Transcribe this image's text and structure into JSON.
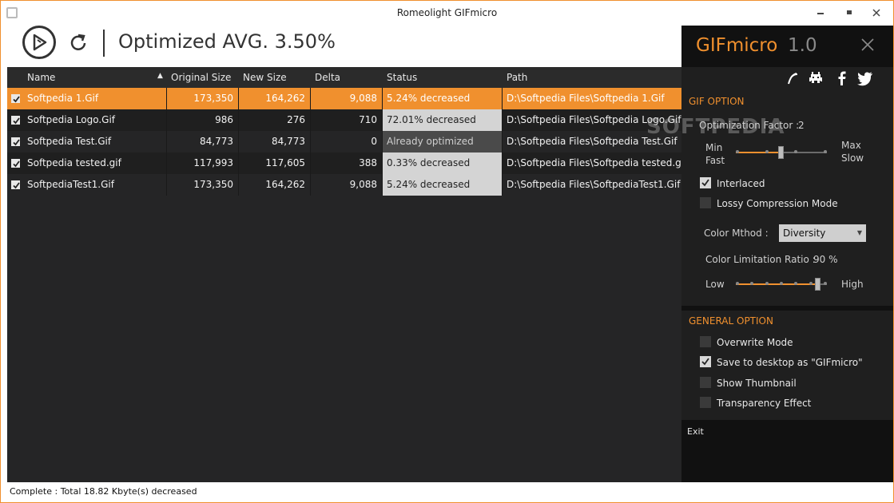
{
  "window": {
    "title": "Romeolight GIFmicro",
    "minimize_glyph": "▬",
    "maximize_glyph": "▪",
    "close_glyph": "✕"
  },
  "toolbar": {
    "optimized_text": "Optimized AVG. 3.50%"
  },
  "table": {
    "headers": {
      "name": "Name",
      "original_size": "Original Size",
      "new_size": "New Size",
      "delta": "Delta",
      "status": "Status",
      "path": "Path"
    },
    "sort_indicator": "▲",
    "rows": [
      {
        "checked": true,
        "name": "Softpedia 1.Gif",
        "original_size": "173,350",
        "new_size": "164,262",
        "delta": "9,088",
        "status": "5.24% decreased",
        "path": "D:\\Softpedia Files\\Softpedia 1.Gif",
        "selected": true
      },
      {
        "checked": true,
        "name": "Softpedia Logo.Gif",
        "original_size": "986",
        "new_size": "276",
        "delta": "710",
        "status": "72.01% decreased",
        "path": "D:\\Softpedia Files\\Softpedia Logo.Gif",
        "selected": false
      },
      {
        "checked": true,
        "name": "Softpedia Test.Gif",
        "original_size": "84,773",
        "new_size": "84,773",
        "delta": "0",
        "status": "Already optimized",
        "path": "D:\\Softpedia Files\\Softpedia Test.Gif",
        "selected": false
      },
      {
        "checked": true,
        "name": "Softpedia tested.gif",
        "original_size": "117,993",
        "new_size": "117,605",
        "delta": "388",
        "status": "0.33% decreased",
        "path": "D:\\Softpedia Files\\Softpedia tested.gif",
        "selected": false
      },
      {
        "checked": true,
        "name": "SoftpediaTest1.Gif",
        "original_size": "173,350",
        "new_size": "164,262",
        "delta": "9,088",
        "status": "5.24% decreased",
        "path": "D:\\Softpedia Files\\SoftpediaTest1.Gif",
        "selected": false
      }
    ]
  },
  "statusbar": {
    "text": "Complete : Total 18.82 Kbyte(s) decreased"
  },
  "panel": {
    "brand": "GIFmicro",
    "version": "1.0",
    "gif_option": {
      "title": "GIF OPTION",
      "optimization_factor_label": "Optimization Factor :",
      "optimization_factor_value": "2",
      "optimization_factor_level": 0.5,
      "min_label": "Min",
      "fast_label": "Fast",
      "max_label": "Max",
      "slow_label": "Slow",
      "interlaced_label": "Interlaced",
      "interlaced_checked": true,
      "lossy_label": "Lossy Compression Mode",
      "lossy_checked": false,
      "color_method_label": "Color Mthod :",
      "color_method_value": "Diversity",
      "color_limit_label": "Color Limitation Ratio :",
      "color_limit_value": "90 %",
      "color_limit_level": 0.9,
      "low_label": "Low",
      "high_label": "High"
    },
    "general_option": {
      "title": "GENERAL OPTION",
      "overwrite_label": "Overwrite Mode",
      "overwrite_checked": false,
      "save_desktop_label": "Save to desktop as \"GIFmicro\"",
      "save_desktop_checked": true,
      "thumbnail_label": "Show Thumbnail",
      "thumbnail_checked": false,
      "transparency_label": "Transparency Effect",
      "transparency_checked": false
    },
    "exit_label": "Exit"
  },
  "watermark": "SOFTPEDIA",
  "colors": {
    "accent": "#f0902e",
    "background": "#252526",
    "panel": "#1f1f1f"
  }
}
